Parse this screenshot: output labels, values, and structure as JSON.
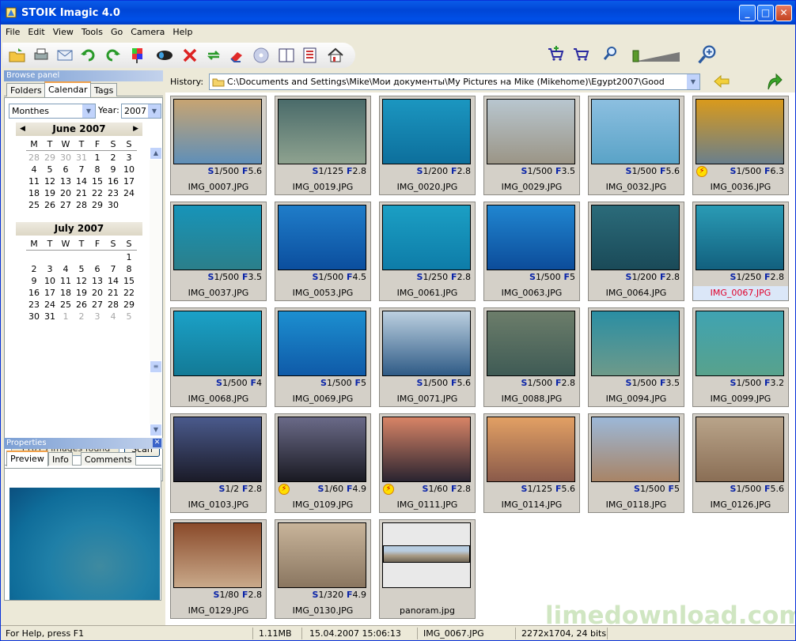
{
  "window": {
    "title": "STOIK Imagic 4.0",
    "min": "_",
    "max": "□",
    "close": "✕"
  },
  "menu": [
    "File",
    "Edit",
    "View",
    "Tools",
    "Go",
    "Camera",
    "Help"
  ],
  "browse": {
    "panel_title": "Browse panel",
    "tabs": [
      "Folders",
      "Calendar",
      "Tags"
    ],
    "group_by": "Monthes",
    "year_label": "Year:",
    "year": "2007",
    "months": [
      {
        "name": "June 2007",
        "weekdays": [
          "M",
          "T",
          "W",
          "T",
          "F",
          "S",
          "S"
        ],
        "rows": [
          [
            "28",
            "29",
            "30",
            "31",
            "1",
            "2",
            "3"
          ],
          [
            "4",
            "5",
            "6",
            "7",
            "8",
            "9",
            "10"
          ],
          [
            "11",
            "12",
            "13",
            "14",
            "15",
            "16",
            "17"
          ],
          [
            "18",
            "19",
            "20",
            "21",
            "22",
            "23",
            "24"
          ],
          [
            "25",
            "26",
            "27",
            "28",
            "29",
            "30",
            ""
          ]
        ]
      },
      {
        "name": "July 2007",
        "weekdays": [
          "M",
          "T",
          "W",
          "T",
          "F",
          "S",
          "S"
        ],
        "rows": [
          [
            "",
            "",
            "",
            "",
            "",
            "",
            "1"
          ],
          [
            "2",
            "3",
            "4",
            "5",
            "6",
            "7",
            "8"
          ],
          [
            "9",
            "10",
            "11",
            "12",
            "13",
            "14",
            "15"
          ],
          [
            "16",
            "17",
            "18",
            "19",
            "20",
            "21",
            "22"
          ],
          [
            "23",
            "24",
            "25",
            "26",
            "27",
            "28",
            "29"
          ],
          [
            "30",
            "31",
            "1",
            "2",
            "3",
            "4",
            "5"
          ]
        ]
      }
    ],
    "found": "11013 images found",
    "scan": "Scan"
  },
  "properties": {
    "title": "Properties",
    "tabs": [
      "Preview",
      "Info",
      "Comments"
    ]
  },
  "history": {
    "label": "History:",
    "path": "C:\\Documents and Settings\\Mike\\Мои документы\\My Pictures на Mike (Mikehome)\\Egypt2007\\Good"
  },
  "thumbs": [
    {
      "name": "IMG_0007.JPG",
      "s": "1/500",
      "f": "5.6",
      "flash": false,
      "c1": "#c7a472",
      "c2": "#5f8fb8"
    },
    {
      "name": "IMG_0019.JPG",
      "s": "1/125",
      "f": "2.8",
      "flash": false,
      "c1": "#4a6b6a",
      "c2": "#8ea28f"
    },
    {
      "name": "IMG_0020.JPG",
      "s": "1/200",
      "f": "2.8",
      "flash": false,
      "c1": "#1b96c0",
      "c2": "#0d6f9c"
    },
    {
      "name": "IMG_0029.JPG",
      "s": "1/500",
      "f": "3.5",
      "flash": false,
      "c1": "#b8c6cf",
      "c2": "#9b9586"
    },
    {
      "name": "IMG_0032.JPG",
      "s": "1/500",
      "f": "5.6",
      "flash": false,
      "c1": "#8cbfe0",
      "c2": "#5aa3c7"
    },
    {
      "name": "IMG_0036.JPG",
      "s": "1/500",
      "f": "6.3",
      "flash": true,
      "c1": "#d99a1c",
      "c2": "#6a7f8c"
    },
    {
      "name": "IMG_0037.JPG",
      "s": "1/500",
      "f": "3.5",
      "flash": false,
      "c1": "#1794b9",
      "c2": "#2b7f8a"
    },
    {
      "name": "IMG_0053.JPG",
      "s": "1/500",
      "f": "4.5",
      "flash": false,
      "c1": "#1f7dc9",
      "c2": "#0b4e9e"
    },
    {
      "name": "IMG_0061.JPG",
      "s": "1/250",
      "f": "2.8",
      "flash": false,
      "c1": "#1b9fc4",
      "c2": "#0e7ca8"
    },
    {
      "name": "IMG_0063.JPG",
      "s": "1/500",
      "f": "5",
      "flash": false,
      "c1": "#2086d0",
      "c2": "#0c4c9a"
    },
    {
      "name": "IMG_0064.JPG",
      "s": "1/200",
      "f": "2.8",
      "flash": false,
      "c1": "#2b6b7a",
      "c2": "#1a4a58"
    },
    {
      "name": "IMG_0067.JPG",
      "s": "1/250",
      "f": "2.8",
      "flash": false,
      "c1": "#2a9bb5",
      "c2": "#12607e"
    },
    {
      "name": "IMG_0068.JPG",
      "s": "1/500",
      "f": "4",
      "flash": false,
      "c1": "#1ba1c7",
      "c2": "#137a96"
    },
    {
      "name": "IMG_0069.JPG",
      "s": "1/500",
      "f": "5",
      "flash": false,
      "c1": "#1c8fd0",
      "c2": "#0f5aa8"
    },
    {
      "name": "IMG_0071.JPG",
      "s": "1/500",
      "f": "5.6",
      "flash": false,
      "c1": "#bcd0e0",
      "c2": "#2f5b86"
    },
    {
      "name": "IMG_0088.JPG",
      "s": "1/500",
      "f": "2.8",
      "flash": false,
      "c1": "#6c7d6a",
      "c2": "#3f5b55"
    },
    {
      "name": "IMG_0094.JPG",
      "s": "1/500",
      "f": "3.5",
      "flash": false,
      "c1": "#2a8ea3",
      "c2": "#6e9a8a"
    },
    {
      "name": "IMG_0099.JPG",
      "s": "1/500",
      "f": "3.2",
      "flash": false,
      "c1": "#3fa3b2",
      "c2": "#58a28c"
    },
    {
      "name": "IMG_0103.JPG",
      "s": "1/2",
      "f": "2.8",
      "flash": false,
      "c1": "#4a5a8c",
      "c2": "#1b1b28"
    },
    {
      "name": "IMG_0109.JPG",
      "s": "1/60",
      "f": "4.9",
      "flash": true,
      "c1": "#6a6a88",
      "c2": "#1a1a22"
    },
    {
      "name": "IMG_0111.JPG",
      "s": "1/60",
      "f": "2.8",
      "flash": true,
      "c1": "#d88466",
      "c2": "#2a2430"
    },
    {
      "name": "IMG_0114.JPG",
      "s": "1/125",
      "f": "5.6",
      "flash": false,
      "c1": "#e2a064",
      "c2": "#8a5a4a"
    },
    {
      "name": "IMG_0118.JPG",
      "s": "1/500",
      "f": "5",
      "flash": false,
      "c1": "#9cb8d8",
      "c2": "#a88466"
    },
    {
      "name": "IMG_0126.JPG",
      "s": "1/500",
      "f": "5.6",
      "flash": false,
      "c1": "#b9a48a",
      "c2": "#8a6e55"
    },
    {
      "name": "IMG_0129.JPG",
      "s": "1/80",
      "f": "2.8",
      "flash": false,
      "c1": "#8a4a2a",
      "c2": "#c9a98a"
    },
    {
      "name": "IMG_0130.JPG",
      "s": "1/320",
      "f": "4.9",
      "flash": false,
      "c1": "#c8b49a",
      "c2": "#8a7660"
    },
    {
      "name": "panoram.jpg",
      "s": "",
      "f": "",
      "flash": false,
      "c1": "#e9e9e9",
      "c2": "#e9e9e9",
      "pano": true
    }
  ],
  "status": {
    "help": "For Help, press F1",
    "size": "1.11MB",
    "date": "15.04.2007 15:06:13",
    "file": "IMG_0067.JPG",
    "dims": "2272x1704, 24 bits"
  },
  "watermark": "limedownload.com"
}
